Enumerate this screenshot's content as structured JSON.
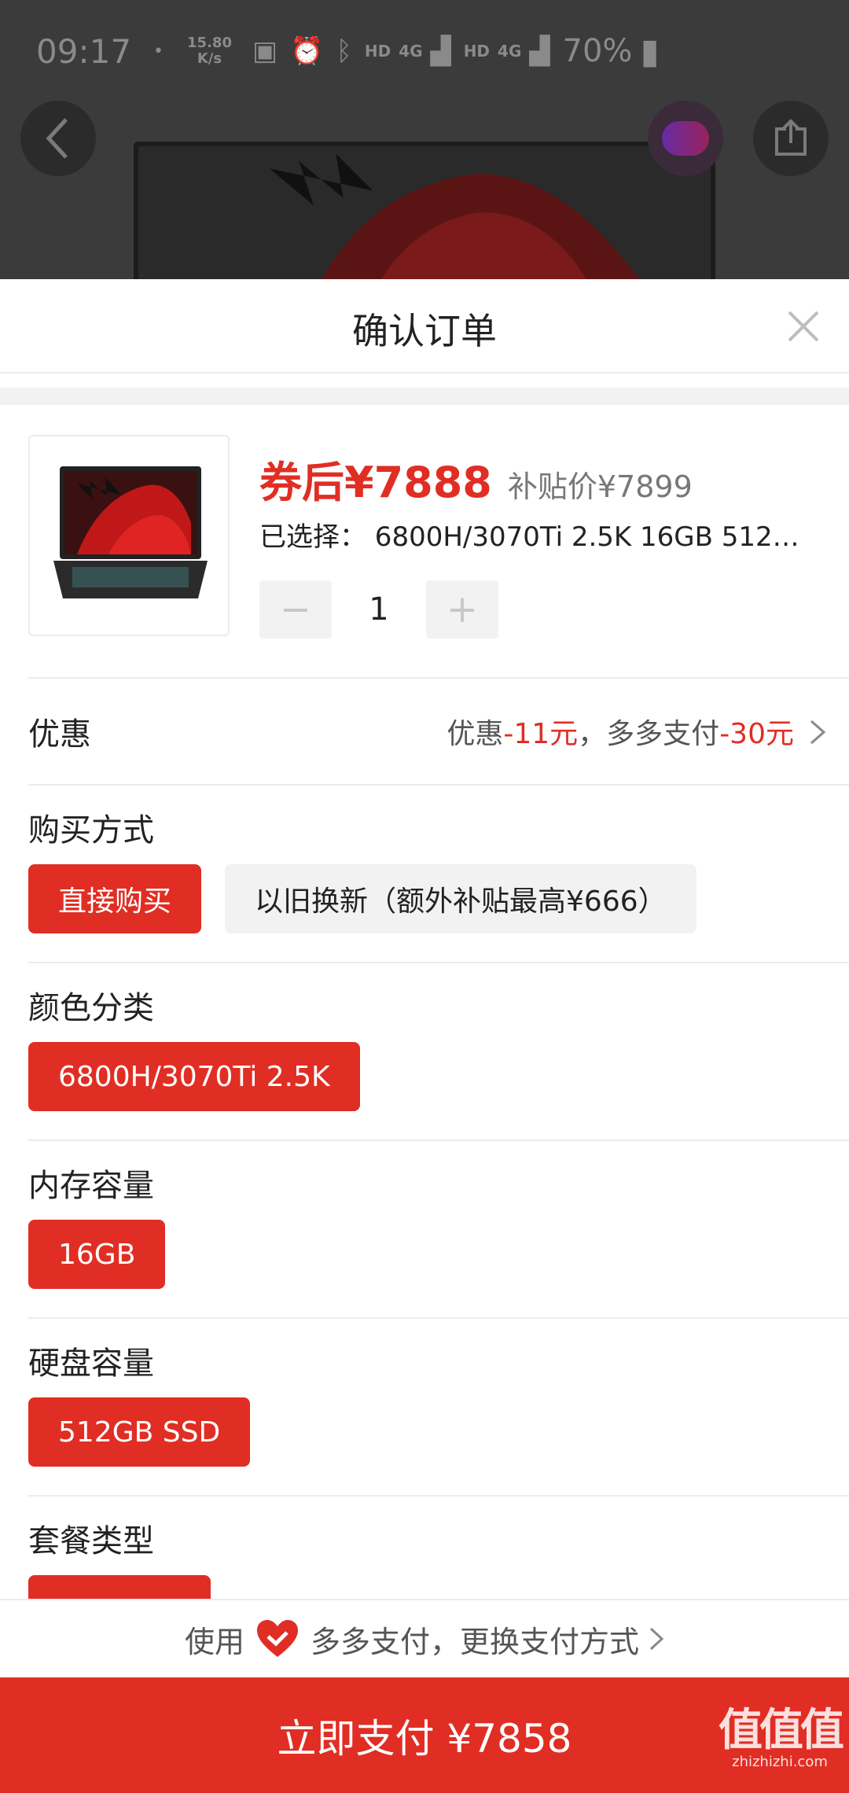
{
  "status_bar": {
    "time": "09:17",
    "dot": "•",
    "speed_value": "15.80",
    "speed_unit": "K/s",
    "hd1": "HD",
    "net1": "4G",
    "hd2": "HD",
    "net2": "4G",
    "battery": "70%"
  },
  "sheet": {
    "title": "确认订单"
  },
  "product": {
    "price_label": "券后¥7888",
    "subsidy_price": "补贴价¥7899",
    "selected": "已选择： 6800H/3070Ti 2.5K 16GB 512…",
    "quantity": "1",
    "minus": "−",
    "plus": "+"
  },
  "discount": {
    "label": "优惠",
    "part1": "优惠",
    "amount1": "-11元",
    "part2": "，多多支付",
    "amount2": "-30元"
  },
  "sections": {
    "purchase": {
      "label": "购买方式",
      "options": [
        "直接购买",
        "以旧换新（额外补贴最高¥666）"
      ]
    },
    "color": {
      "label": "颜色分类",
      "options": [
        "6800H/3070Ti 2.5K"
      ]
    },
    "memory": {
      "label": "内存容量",
      "options": [
        "16GB"
      ]
    },
    "disk": {
      "label": "硬盘容量",
      "options": [
        "512GB SSD"
      ]
    },
    "package": {
      "label": "套餐类型"
    }
  },
  "payment": {
    "use": "使用",
    "method": "多多支付，更换支付方式",
    "button": "立即支付 ¥7858"
  },
  "watermark": {
    "big": "值值值",
    "small": "zhizhizhi.com"
  },
  "colors": {
    "accent": "#e02e24",
    "chip_off": "#f2f2f2",
    "divider": "#ececec"
  }
}
